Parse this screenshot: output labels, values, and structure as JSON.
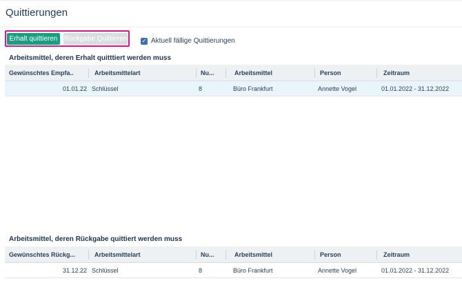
{
  "page": {
    "title": "Quittierungen"
  },
  "toolbar": {
    "confirm_receipt_label": "Erhalt quittieren",
    "confirm_return_label": "Rückgabe Quittieren",
    "due_checkbox_label": "Aktuell fällige Quittierungen",
    "due_checkbox_checked": true
  },
  "receipt_section": {
    "title": "Arbeitsmittel, deren Erhalt quitttiert werden muss",
    "columns": [
      "Gewünschtes Empfa...",
      "Arbeitsmittelart",
      "Nu...",
      "Arbeitsmittel",
      "Person",
      "Zeitraum"
    ],
    "sort_indicator": "↑",
    "rows": [
      [
        "01.01.22",
        "Schlüssel",
        "8",
        "Büro Frankfurt",
        "Annette Vogel",
        "01.01.2022 - 31.12.2022"
      ]
    ]
  },
  "return_section": {
    "title": "Arbeitsmittel, deren Rückgabe quittiert werden muss",
    "columns": [
      "Gewünschtes Rückg...",
      "Arbeitsmittelart",
      "Nu...",
      "Arbeitsmittel",
      "Person",
      "Zeitraum"
    ],
    "rows": [
      [
        "31.12.22",
        "Schlüssel",
        "8",
        "Büro Frankfurt",
        "Annette Vogel",
        "01.01.2022 - 31.12.2022"
      ]
    ]
  },
  "colors": {
    "primary_button": "#1a9e82",
    "highlight_border": "#e0128a",
    "selected_row": "#eaf4fd"
  }
}
